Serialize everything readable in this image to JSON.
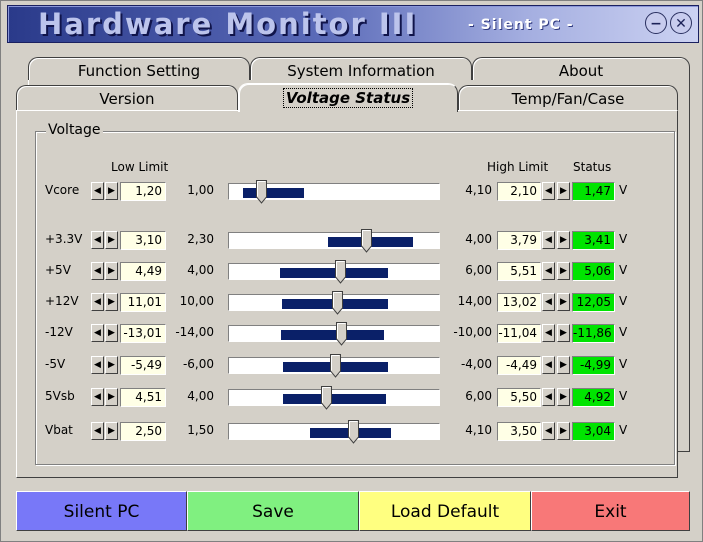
{
  "window": {
    "title": "Hardware Monitor III",
    "subtitle": "- Silent PC -"
  },
  "tabs_top": [
    "Function Setting",
    "System Information",
    "About"
  ],
  "tabs_bottom": [
    "Version",
    "Voltage Status",
    "Temp/Fan/Case"
  ],
  "active_tab": "Voltage Status",
  "group": {
    "label": "Voltage",
    "header_low": "Low Limit",
    "header_high": "High Limit",
    "header_status": "Status",
    "unit": "V"
  },
  "rows": [
    {
      "label": "Vcore",
      "low_limit": "1,20",
      "min": "1,00",
      "max": "4,10",
      "high_limit": "2,10",
      "status": "1,47",
      "range": [
        1.2,
        2.1
      ],
      "value": 1.47,
      "scale": [
        1.0,
        4.1
      ]
    },
    {
      "label": "+3.3V",
      "low_limit": "3,10",
      "min": "2,30",
      "max": "4,00",
      "high_limit": "3,79",
      "status": "3,41",
      "range": [
        3.1,
        3.79
      ],
      "value": 3.41,
      "scale": [
        2.3,
        4.0
      ]
    },
    {
      "label": "+5V",
      "low_limit": "4,49",
      "min": "4,00",
      "max": "6,00",
      "high_limit": "5,51",
      "status": "5,06",
      "range": [
        4.49,
        5.51
      ],
      "value": 5.06,
      "scale": [
        4.0,
        6.0
      ]
    },
    {
      "label": "+12V",
      "low_limit": "11,01",
      "min": "10,00",
      "max": "14,00",
      "high_limit": "13,02",
      "status": "12,05",
      "range": [
        11.01,
        13.02
      ],
      "value": 12.05,
      "scale": [
        10.0,
        14.0
      ]
    },
    {
      "label": "-12V",
      "low_limit": "-13,01",
      "min": "-14,00",
      "max": "-10,00",
      "high_limit": "-11,04",
      "status": "-11,86",
      "range": [
        -13.01,
        -11.04
      ],
      "value": -11.86,
      "scale": [
        -14.0,
        -10.0
      ]
    },
    {
      "label": "-5V",
      "low_limit": "-5,49",
      "min": "-6,00",
      "max": "-4,00",
      "high_limit": "-4,49",
      "status": "-4,99",
      "range": [
        -5.49,
        -4.49
      ],
      "value": -4.99,
      "scale": [
        -6.0,
        -4.0
      ]
    },
    {
      "label": "5Vsb",
      "low_limit": "4,51",
      "min": "4,00",
      "max": "6,00",
      "high_limit": "5,50",
      "status": "4,92",
      "range": [
        4.51,
        5.5
      ],
      "value": 4.92,
      "scale": [
        4.0,
        6.0
      ]
    },
    {
      "label": "Vbat",
      "low_limit": "2,50",
      "min": "1,50",
      "max": "4,10",
      "high_limit": "3,50",
      "status": "3,04",
      "range": [
        2.5,
        3.5
      ],
      "value": 3.04,
      "scale": [
        1.5,
        4.1
      ]
    }
  ],
  "buttons": [
    {
      "label": "Silent PC",
      "color": "#7878f8"
    },
    {
      "label": "Save",
      "color": "#80f080"
    },
    {
      "label": "Load Default",
      "color": "#ffff80"
    },
    {
      "label": "Exit",
      "color": "#f87878"
    }
  ],
  "colors": {
    "status_ok": "#00e400",
    "range_fill": "#0a2068",
    "field_bg": "#ffffe6"
  },
  "icons": {
    "minimize": "minimize-icon",
    "close": "close-icon",
    "arrow_left": "arrow-left-icon",
    "arrow_right": "arrow-right-icon"
  }
}
